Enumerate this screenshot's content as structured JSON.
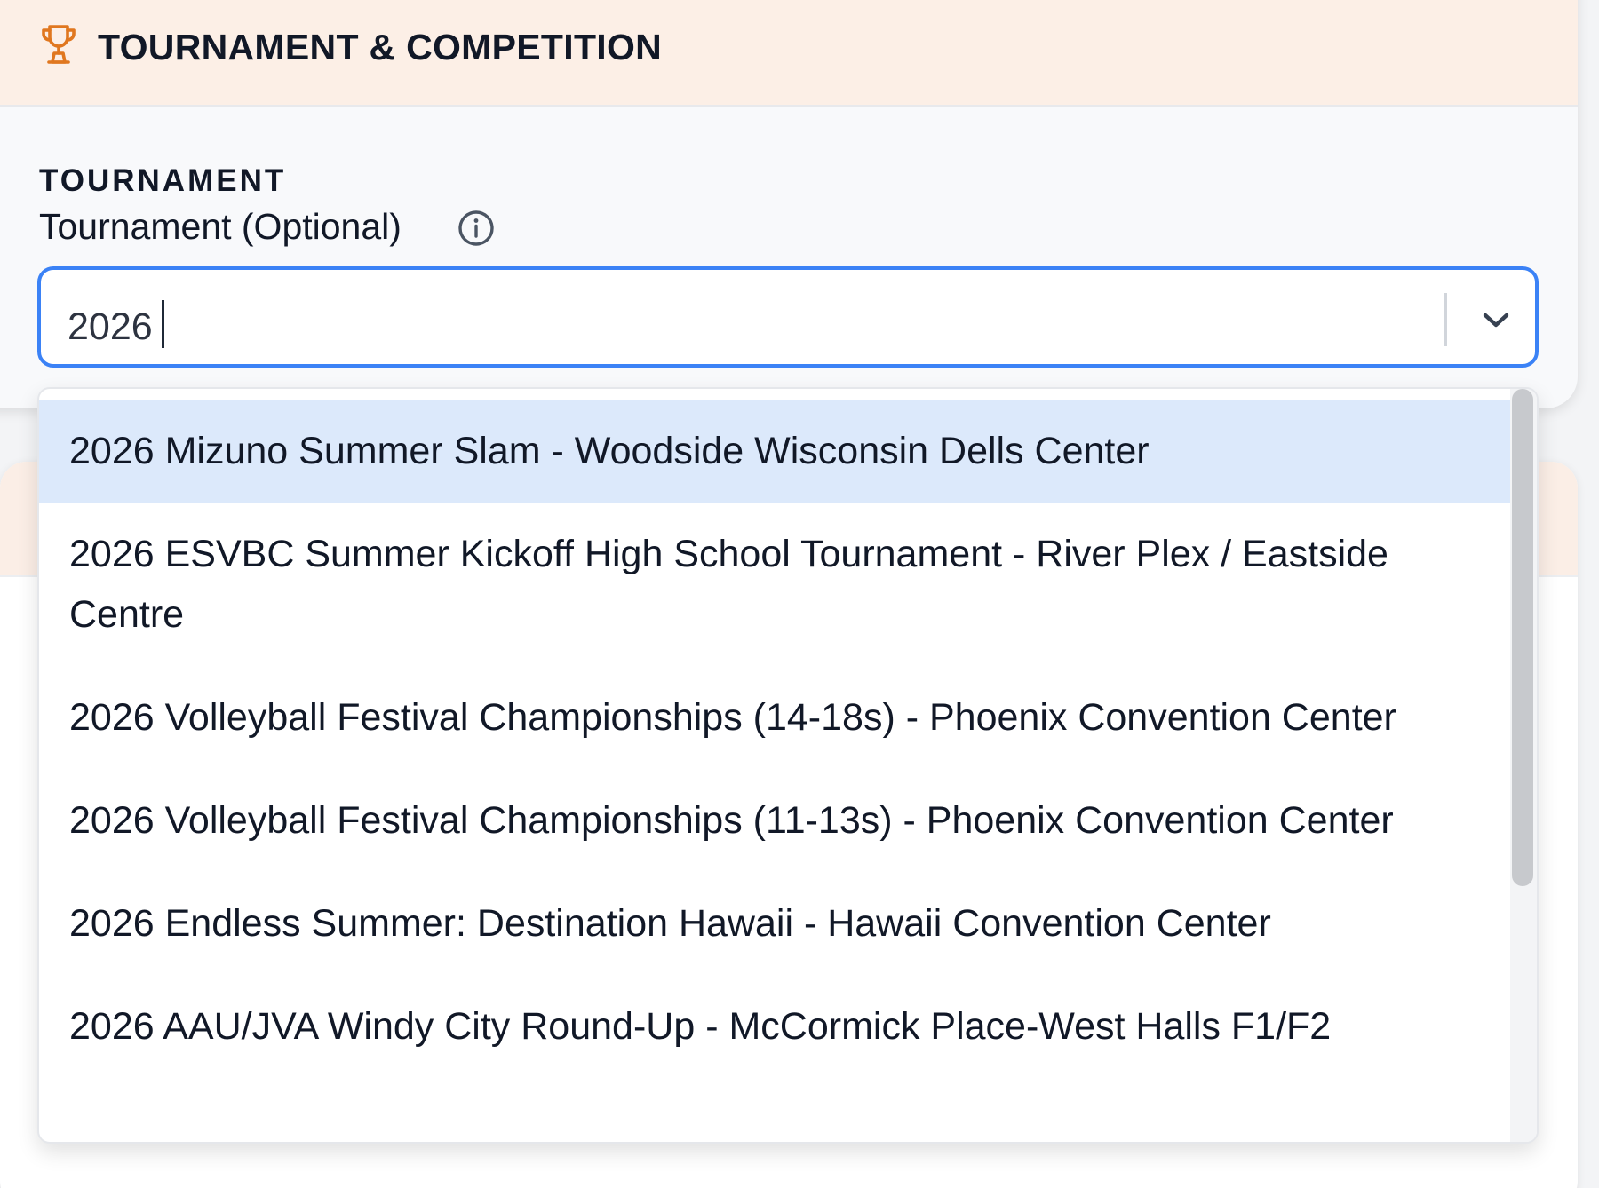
{
  "header": {
    "title": "TOURNAMENT & COMPETITION",
    "icon": "trophy-icon",
    "accent_color": "#e0771f"
  },
  "field": {
    "section_label": "TOURNAMENT",
    "label": "Tournament (Optional)",
    "info_icon": "info-icon",
    "input_value": "2026",
    "focus_color": "#3b82f6"
  },
  "dropdown": {
    "options": [
      "2026 Mizuno Summer Slam - Woodside Wisconsin Dells Center",
      "2026 ESVBC Summer Kickoff High School Tournament - River Plex / Eastside Centre",
      "2026 Volleyball Festival Championships (14-18s) - Phoenix Convention Center",
      "2026 Volleyball Festival Championships (11-13s) - Phoenix Convention Center",
      "2026 Endless Summer: Destination Hawaii - Hawaii Convention Center",
      "2026 AAU/JVA Windy City Round-Up - McCormick Place-West Halls F1/F2"
    ],
    "highlighted_index": 0,
    "highlight_color": "#dce9fb"
  }
}
